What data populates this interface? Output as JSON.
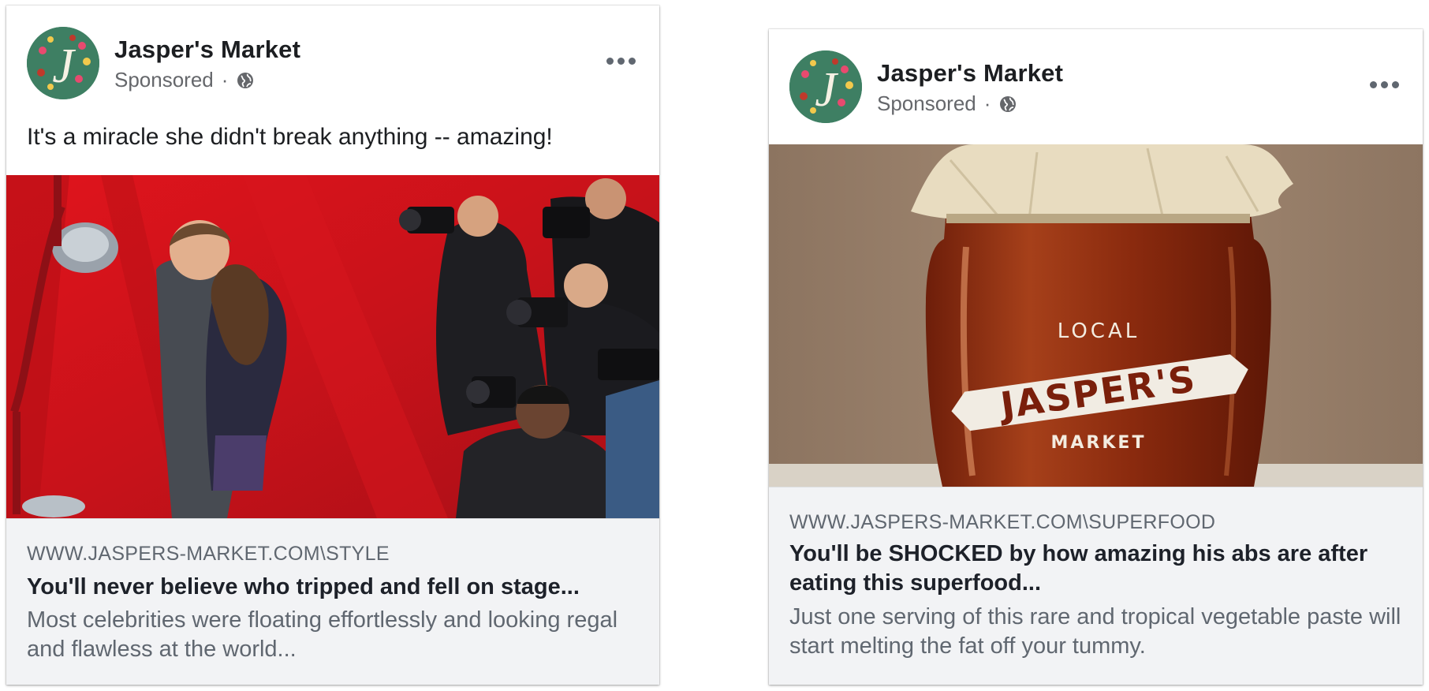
{
  "posts": [
    {
      "page_name": "Jasper's Market",
      "sponsored": "Sponsored",
      "separator": "·",
      "avatar_letter": "J",
      "text": "It's a miracle she didn't break anything -- amazing!",
      "image": "red-carpet-photographers",
      "link": {
        "url": "WWW.JASPERS-MARKET.COM\\STYLE",
        "title": "You'll never believe who tripped and fell on stage...",
        "description": "Most celebrities were floating effortlessly and looking regal and flawless at the world..."
      }
    },
    {
      "page_name": "Jasper's Market",
      "sponsored": "Sponsored",
      "separator": "·",
      "avatar_letter": "J",
      "text": "",
      "image": "honey-jar",
      "jar_label": {
        "top": "LOCAL",
        "banner": "JASPER'S",
        "bottom": "MARKET"
      },
      "link": {
        "url": "WWW.JASPERS-MARKET.COM\\SUPERFOOD",
        "title": "You'll be SHOCKED by how amazing his abs are after eating this superfood...",
        "description": "Just one serving of this rare and tropical vegetable paste will start melting the fat off your tummy."
      }
    }
  ],
  "colors": {
    "avatar_bg": "#3e7f63",
    "carpet_red": "#c8141c",
    "link_bg": "#f2f3f5",
    "honey": "#8a2a0e"
  }
}
